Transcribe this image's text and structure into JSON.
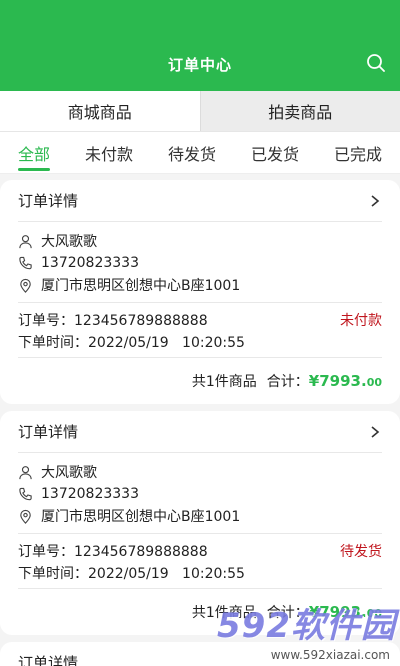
{
  "header": {
    "title": "订单中心"
  },
  "icons": {
    "search": "search-icon",
    "chevron": "chevron-right-icon",
    "user": "user-icon",
    "phone": "phone-icon",
    "location": "location-icon"
  },
  "colors": {
    "accent": "#2bb94f",
    "status_red": "#c0161e"
  },
  "category_tabs": [
    {
      "label": "商城商品",
      "selected": true
    },
    {
      "label": "拍卖商品",
      "selected": false
    }
  ],
  "status_tabs": [
    {
      "label": "全部",
      "active": true
    },
    {
      "label": "未付款",
      "active": false
    },
    {
      "label": "待发货",
      "active": false
    },
    {
      "label": "已发货",
      "active": false
    },
    {
      "label": "已完成",
      "active": false
    }
  ],
  "orders": [
    {
      "title": "订单详情",
      "name": "大风歌歌",
      "phone": "13720823333",
      "address": "厦门市思明区创想中心B座1001",
      "order_no_label": "订单号：",
      "order_no": "123456789888888",
      "time_label": "下单时间：",
      "time": "2022/05/19   10:20:55",
      "status": "未付款",
      "count_text": "共1件商品",
      "total_label": "合计：",
      "price_main": "¥7993.",
      "price_dec": "00"
    },
    {
      "title": "订单详情",
      "name": "大风歌歌",
      "phone": "13720823333",
      "address": "厦门市思明区创想中心B座1001",
      "order_no_label": "订单号：",
      "order_no": "123456789888888",
      "time_label": "下单时间：",
      "time": "2022/05/19   10:20:55",
      "status": "待发货",
      "count_text": "共1件商品",
      "total_label": "合计：",
      "price_main": "¥7993.",
      "price_dec": "00"
    },
    {
      "title": "订单详情"
    }
  ],
  "watermark": {
    "big": "592软件园",
    "small": "www.592xiazai.com"
  }
}
